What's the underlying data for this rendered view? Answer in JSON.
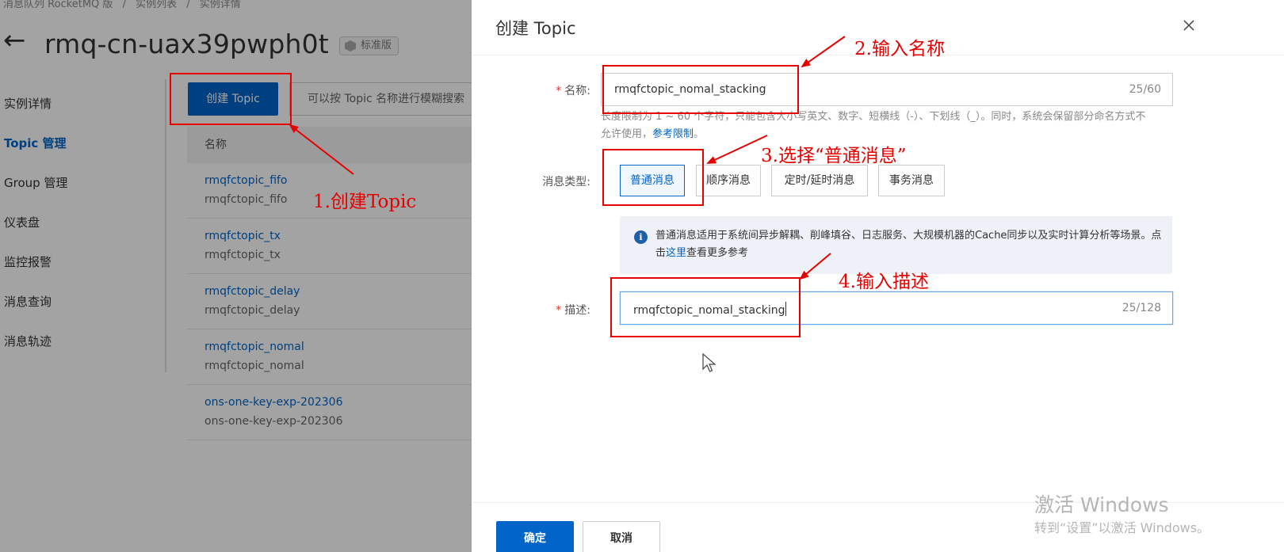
{
  "background": {
    "breadcrumb": [
      "消息队列 RocketMQ 版",
      "/",
      "实例列表",
      "/",
      "实例详情"
    ],
    "instance_title": "rmq-cn-uax39pwph0t",
    "edition": "标准版",
    "nav": [
      "实例详情",
      "Topic 管理",
      "Group 管理",
      "仪表盘",
      "监控报警",
      "消息查询",
      "消息轨迹"
    ],
    "create_button": "创建 Topic",
    "search_placeholder": "可以按 Topic 名称进行模糊搜索",
    "table_header": "名称",
    "rows": [
      {
        "name": "rmqfctopic_fifo",
        "desc": "rmqfctopic_fifo"
      },
      {
        "name": "rmqfctopic_tx",
        "desc": "rmqfctopic_tx"
      },
      {
        "name": "rmqfctopic_delay",
        "desc": "rmqfctopic_delay"
      },
      {
        "name": "rmqfctopic_nomal",
        "desc": "rmqfctopic_nomal"
      },
      {
        "name": "ons-one-key-exp-202306",
        "desc": "ons-one-key-exp-202306"
      }
    ]
  },
  "drawer": {
    "title": "创建 Topic",
    "name_label": "名称:",
    "name_value": "rmqfctopic_nomal_stacking",
    "name_count": "25/60",
    "hint_text": "长度限制为 1 ~ 60 个字符，只能包含大小写英文、数字、短横线（-）、下划线（_）。同时，系统会保留部分命名方式不允许使用，",
    "hint_link": "参考限制",
    "hint_end": "。",
    "type_label": "消息类型:",
    "types": [
      "普通消息",
      "顺序消息",
      "定时/延时消息",
      "事务消息"
    ],
    "selected_type": "普通消息",
    "info_text": "普通消息适用于系统间异步解耦、削峰填谷、日志服务、大规模机器的Cache同步以及实时计算分析等场景。点击",
    "info_link": "这里",
    "info_end": "查看更多参考",
    "desc_label": "描述:",
    "desc_value": "rmqfctopic_nomal_stacking",
    "desc_count": "25/128",
    "ok_button": "确定",
    "cancel_button": "取消"
  },
  "annotations": {
    "step1": "1.创建Topic",
    "step2": "2.输入名称",
    "step3": "3.选择“普通消息”",
    "step4": "4.输入描述"
  },
  "watermark": {
    "line1": "激活 Windows",
    "line2": "转到“设置”以激活 Windows。"
  },
  "colors": {
    "primary": "#0064c8",
    "annotation_red": "#e60000"
  }
}
